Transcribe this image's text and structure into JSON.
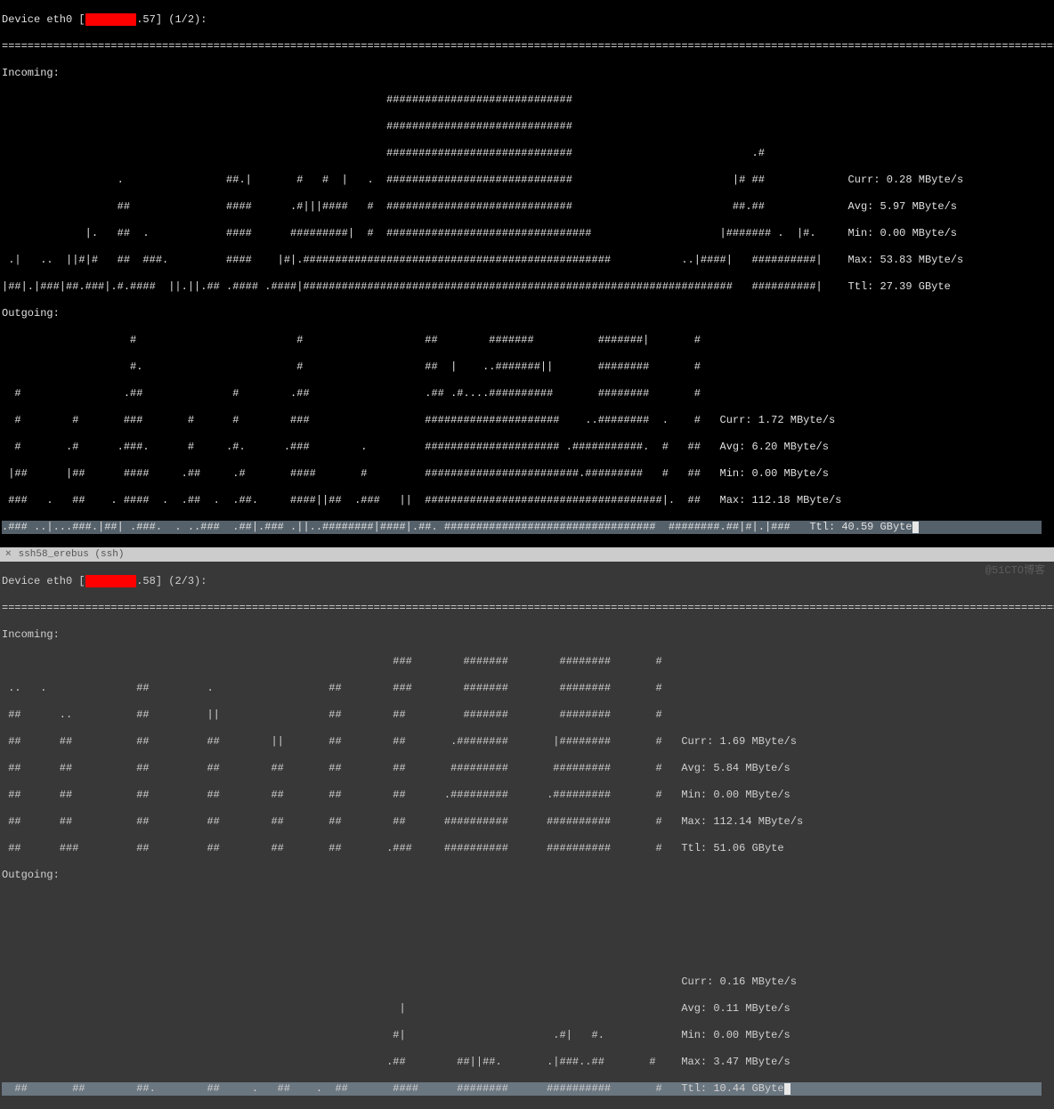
{
  "top": {
    "device_line_prefix": "Device eth0 [",
    "device_ip_suffix": ".57",
    "device_line_suffix": "] (1/2):",
    "hr": "========================================================================================================================================================================",
    "incoming_label": "Incoming:",
    "outgoing_label": "Outgoing:",
    "incoming_art": [
      "                                                            #############################                                                                              ",
      "                                                            #############################                                                                              ",
      "                                                            #############################                            .#                                                ",
      "                  .                ##.|       #   #  |   .  #############################                         |# ##             Curr: 0.28 MByte/s                 ",
      "                  ##               ####      .#|||####   #  #############################                         ##.##             Avg: 5.97 MByte/s                  ",
      "             |.   ##  .            ####      #########|  #  ################################                    |####### .  |#.     Min: 0.00 MByte/s                  ",
      " .|   ..  ||#|#   ##  ###.         ####    |#|.################################################           ..|####|   ##########|    Max: 53.83 MByte/s                 ",
      "|##|.|###|##.###|.#.####  ||.||.## .#### .####|###################################################################   ##########|    Ttl: 27.39 GByte                   "
    ],
    "outgoing_art": [
      "                    #                         #                   ##        #######          #######|       #                                                          ",
      "                    #.                        #                   ##  |    ..#######||       ########       #                                                          ",
      "  #                .##              #        .##                  .## .#....##########       ########       #                                                          ",
      "  #        #       ###       #      #        ###                  #####################    ..########  .    #   Curr: 1.72 MByte/s                                     ",
      "  #       .#      .###.      #     .#.      .###        .         ##################### .###########.  #   ##   Avg: 6.20 MByte/s                                      ",
      " |##      |##      ####     .##     .#       ####       #         ########################.#########   #   ##   Min: 0.00 MByte/s                                      ",
      " ###   .   ##    . ####  .  .##  .  .##.     ####||##  .###   ||  #####################################|.  ##   Max: 112.18 MByte/s                                    "
    ],
    "outgoing_last": ".### ..|...###.|##| .###.  . ..###  .##|.### .||..########|####|.##. #################################  ########.##|#|.|###   Ttl: 40.59 GByte"
  },
  "divider": {
    "x": "×",
    "tab": "ssh58_erebus (ssh)"
  },
  "bottom": {
    "device_line_prefix": "Device eth0 [",
    "device_ip_suffix": ".58",
    "device_line_suffix": "] (2/3):",
    "hr": "========================================================================================================================================================================",
    "incoming_label": "Incoming:",
    "outgoing_label": "Outgoing:",
    "incoming_art": [
      "                                                             ###        #######        ########       #                                                                ",
      " ..   .              ##         .                  ##        ###        #######        ########       #                                                                ",
      " ##      ..          ##         ||                 ##        ##         #######        ########       #                                                                ",
      " ##      ##          ##         ##        ||       ##        ##       .########       |########       #   Curr: 1.69 MByte/s                                           ",
      " ##      ##          ##         ##        ##       ##        ##       #########       #########       #   Avg: 5.84 MByte/s                                            ",
      " ##      ##          ##         ##        ##       ##        ##      .#########      .#########       #   Min: 0.00 MByte/s                                            ",
      " ##      ##          ##         ##        ##       ##        ##      ##########      ##########       #   Max: 112.14 MByte/s                                          ",
      " ##      ###         ##         ##        ##       ##       .###     ##########      ##########       #   Ttl: 51.06 GByte                                             "
    ],
    "outgoing_art": [
      "                                                                                                          Curr: 0.16 MByte/s                                           ",
      "                                                              |                                           Avg: 0.11 MByte/s                                            ",
      "                                                             #|                       .#|   #.            Min: 0.00 MByte/s                                            ",
      "                                                            .##        ##||##.       .|###..##       #    Max: 3.47 MByte/s                                            "
    ],
    "outgoing_last": "  ##       ##        ##.        ##     .   ##    .  ##       ####      ########      ##########       #   Ttl: 10.44 GByte"
  },
  "watermark": "@51CTO博客",
  "chart_data": [
    {
      "type": "area",
      "title": "Device eth0 .57 Incoming",
      "ylabel": "MByte/s",
      "stats": {
        "curr": 0.28,
        "avg": 5.97,
        "min": 0.0,
        "max": 53.83,
        "ttl_gb": 27.39
      }
    },
    {
      "type": "area",
      "title": "Device eth0 .57 Outgoing",
      "ylabel": "MByte/s",
      "stats": {
        "curr": 1.72,
        "avg": 6.2,
        "min": 0.0,
        "max": 112.18,
        "ttl_gb": 40.59
      }
    },
    {
      "type": "area",
      "title": "Device eth0 .58 Incoming",
      "ylabel": "MByte/s",
      "stats": {
        "curr": 1.69,
        "avg": 5.84,
        "min": 0.0,
        "max": 112.14,
        "ttl_gb": 51.06
      }
    },
    {
      "type": "area",
      "title": "Device eth0 .58 Outgoing",
      "ylabel": "MByte/s",
      "stats": {
        "curr": 0.16,
        "avg": 0.11,
        "min": 0.0,
        "max": 3.47,
        "ttl_gb": 10.44
      }
    }
  ]
}
